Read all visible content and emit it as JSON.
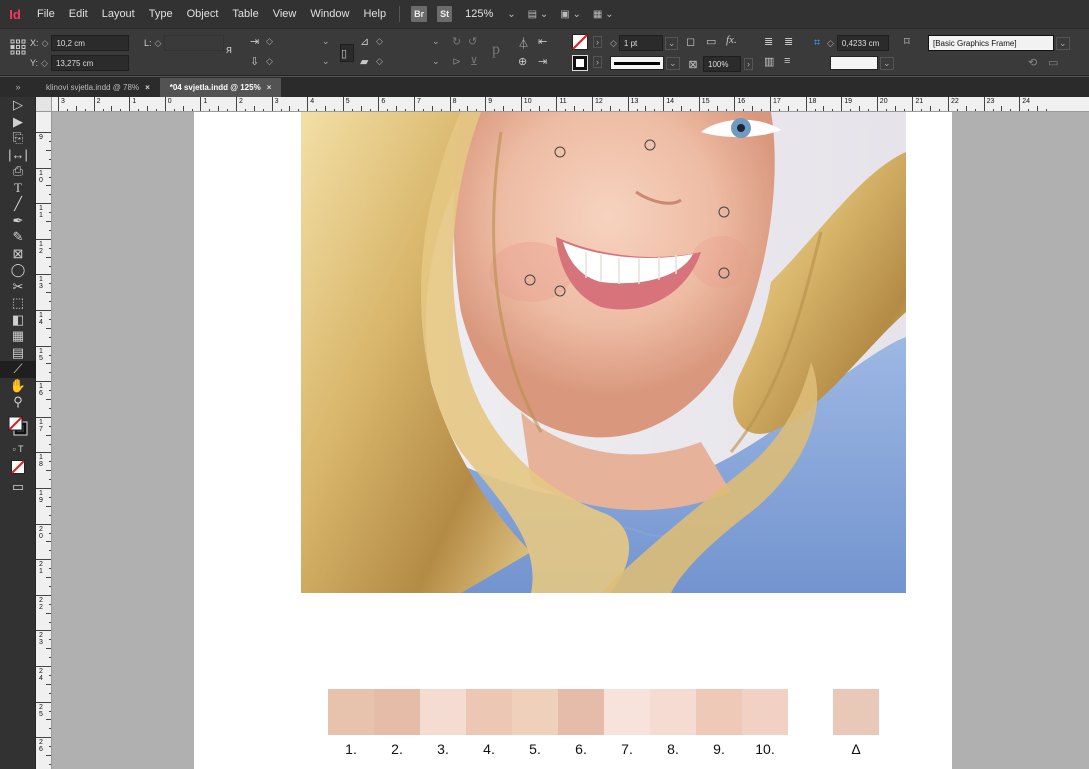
{
  "menubar": {
    "app_logo": "Id",
    "items": [
      "File",
      "Edit",
      "Layout",
      "Type",
      "Object",
      "Table",
      "View",
      "Window",
      "Help"
    ],
    "bridge_badge": "Br",
    "stock_badge": "St",
    "zoom": "125%"
  },
  "control_panel": {
    "x_label": "X:",
    "x_value": "10,2 cm",
    "y_label": "Y:",
    "y_value": "13,275 cm",
    "w_label": "L:",
    "stroke_weight": "1 pt",
    "opacity": "100%",
    "gap_value": "0,4233 cm",
    "object_style": "[Basic Graphics Frame]"
  },
  "tabs": [
    {
      "label": "klinovi svjetla.indd @ 78%",
      "active": false
    },
    {
      "label": "*04 svjetla.indd @ 125%",
      "active": true
    }
  ],
  "ruler_h_labels": [
    "3",
    "2",
    "1",
    "0",
    "1",
    "2",
    "3",
    "4",
    "5",
    "6",
    "7",
    "8",
    "9",
    "10",
    "11",
    "12",
    "13",
    "14",
    "15",
    "16",
    "17",
    "18",
    "19",
    "20",
    "21",
    "22",
    "23",
    "24"
  ],
  "ruler_v_labels": [
    "9",
    "10",
    "11",
    "12",
    "13",
    "14",
    "15",
    "16",
    "17",
    "18",
    "19",
    "20",
    "21",
    "22",
    "23",
    "24",
    "25",
    "26"
  ],
  "swatches": [
    {
      "label": "1.",
      "color": "#e7c2ad"
    },
    {
      "label": "2.",
      "color": "#e5bca7"
    },
    {
      "label": "3.",
      "color": "#f5dcd2"
    },
    {
      "label": "4.",
      "color": "#ecc8b4"
    },
    {
      "label": "5.",
      "color": "#efd0bb"
    },
    {
      "label": "6.",
      "color": "#e5bcaa"
    },
    {
      "label": "7.",
      "color": "#f7e3dc"
    },
    {
      "label": "8.",
      "color": "#f4dcd2"
    },
    {
      "label": "9.",
      "color": "#efc9b7"
    },
    {
      "label": "10.",
      "color": "#f0d1c4"
    },
    {
      "label": "Δ",
      "color": "#e8c8b6"
    }
  ],
  "colors": {
    "app_logo": "#ff3366",
    "ui_dark": "#323232",
    "ui_mid": "#535353",
    "pasteboard": "#b0b0b0",
    "selection_blue": "#4aa3ff"
  }
}
